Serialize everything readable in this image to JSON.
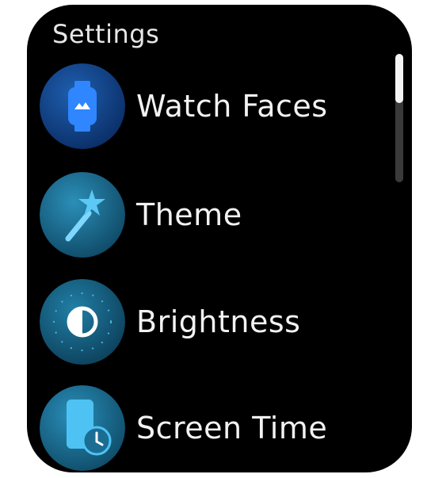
{
  "header": {
    "title": "Settings"
  },
  "menu": {
    "items": [
      {
        "label": "Watch Faces",
        "icon": "watch-face-icon"
      },
      {
        "label": "Theme",
        "icon": "magic-wand-icon"
      },
      {
        "label": "Brightness",
        "icon": "brightness-icon"
      },
      {
        "label": "Screen Time",
        "icon": "screen-time-icon"
      }
    ]
  },
  "colors": {
    "background": "#000000",
    "text": "#f2f2f2",
    "watch_faces_accent": "#1a73e8",
    "theme_accent": "#1e7ea8",
    "brightness_accent": "#1a6f92",
    "screen_time_accent": "#2589b3"
  },
  "scrollbar": {
    "position_fraction": 0.0
  }
}
